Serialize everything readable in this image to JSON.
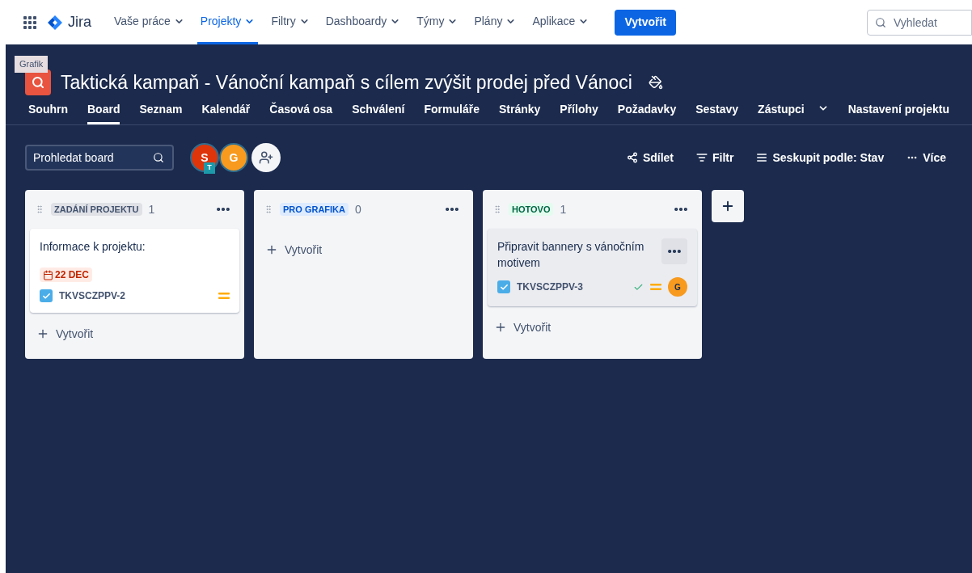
{
  "top_nav": {
    "logo": "Jira",
    "items": [
      {
        "label": "Vaše práce",
        "selected": false
      },
      {
        "label": "Projekty",
        "selected": true
      },
      {
        "label": "Filtry",
        "selected": false
      },
      {
        "label": "Dashboardy",
        "selected": false
      },
      {
        "label": "Týmy",
        "selected": false
      },
      {
        "label": "Plány",
        "selected": false
      },
      {
        "label": "Aplikace",
        "selected": false
      }
    ],
    "create_button": "Vytvořit",
    "search": {
      "placeholder": "Vyhledat"
    }
  },
  "project": {
    "tooltip": "Grafik",
    "title": "Taktická kampaň - Vánoční kampaň s cílem zvýšit prodej před Vánoci"
  },
  "tabs": [
    {
      "label": "Souhrn",
      "selected": false,
      "has_menu": false
    },
    {
      "label": "Board",
      "selected": true,
      "has_menu": false
    },
    {
      "label": "Seznam",
      "selected": false,
      "has_menu": false
    },
    {
      "label": "Kalendář",
      "selected": false,
      "has_menu": false
    },
    {
      "label": "Časová osa",
      "selected": false,
      "has_menu": false
    },
    {
      "label": "Schválení",
      "selected": false,
      "has_menu": false
    },
    {
      "label": "Formuláře",
      "selected": false,
      "has_menu": false
    },
    {
      "label": "Stránky",
      "selected": false,
      "has_menu": false
    },
    {
      "label": "Přílohy",
      "selected": false,
      "has_menu": false
    },
    {
      "label": "Požadavky",
      "selected": false,
      "has_menu": false
    },
    {
      "label": "Sestavy",
      "selected": false,
      "has_menu": false
    },
    {
      "label": "Zástupci",
      "selected": false,
      "has_menu": true
    },
    {
      "label": "Nastavení projektu",
      "selected": false,
      "has_menu": false
    }
  ],
  "toolbar": {
    "search": {
      "placeholder": "Prohledat board"
    },
    "avatars": [
      {
        "initial": "S",
        "color": "#de350b",
        "badge": "T"
      },
      {
        "initial": "G",
        "color": "#f79a1e"
      }
    ],
    "actions": [
      {
        "kind": "share",
        "label": "Sdílet"
      },
      {
        "kind": "filter",
        "label": "Filtr"
      },
      {
        "kind": "group",
        "label": "Seskupit podle: Stav"
      },
      {
        "kind": "more",
        "label": "Více"
      }
    ]
  },
  "columns": [
    {
      "title": "ZADÁNÍ PROJEKTU",
      "count": "1",
      "kind": "todo",
      "create_label": "Vytvořit",
      "cards": [
        {
          "title": "Informace k projektu:",
          "due": "22 DEC",
          "key": "TKVSCZPPV-2",
          "resolved": false,
          "hovered": false
        }
      ]
    },
    {
      "title": "PRO GRAFIKA",
      "count": "0",
      "kind": "progress",
      "create_label": "Vytvořit"
    },
    {
      "title": "HOTOVO",
      "count": "1",
      "kind": "done",
      "create_label": "Vytvořit",
      "cards": [
        {
          "title": "Připravit bannery s vánočním motivem",
          "key": "TKVSCZPPV-3",
          "resolved": true,
          "assignee": {
            "initial": "G",
            "color": "#f79a1e"
          },
          "hovered": true
        }
      ]
    }
  ]
}
